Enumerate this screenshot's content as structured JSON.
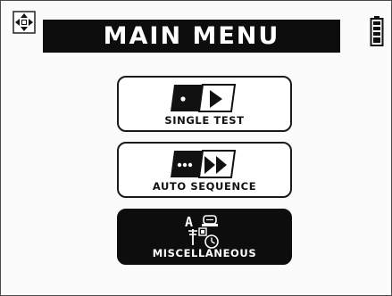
{
  "header": {
    "title": "MAIN MENU"
  },
  "menu": {
    "items": [
      {
        "label": "SINGLE TEST",
        "icon": "single-test-icon",
        "selected": false
      },
      {
        "label": "AUTO SEQUENCE",
        "icon": "auto-sequence-icon",
        "selected": false
      },
      {
        "label": "MISCELLANEOUS",
        "icon": "miscellaneous-icon",
        "selected": true
      }
    ]
  },
  "colors": {
    "screen_bg": "#fbfbfb",
    "highlight": "#0d0d0d",
    "text_dark": "#111111",
    "text_light": "#ffffff"
  }
}
